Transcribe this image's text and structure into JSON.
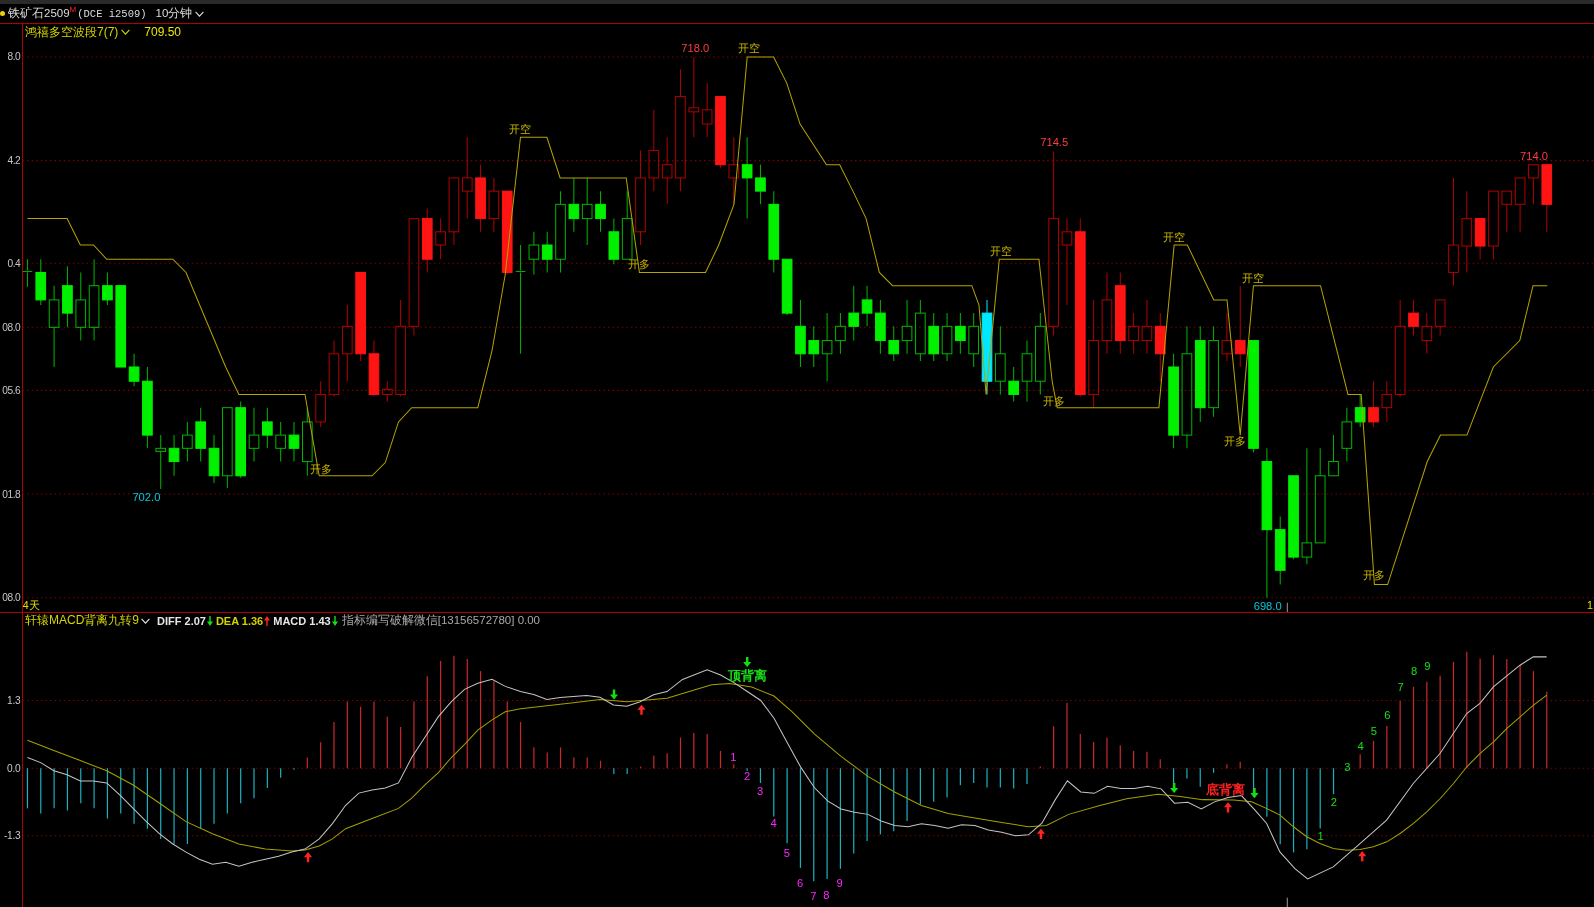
{
  "title_bar": {
    "symbol": "铁矿石2509$^{M}$",
    "exchange_code": "(DCE i2509)",
    "period": "10分钟"
  },
  "price_chart": {
    "legend": {
      "name": "鸿禧多空波段7(7)",
      "value": "709.50"
    },
    "y_axis_labels": [
      "8.0",
      "4.2",
      "0.4",
      "08.0",
      "05.6",
      "01.8",
      "08.0"
    ],
    "signals": [
      "开多",
      "开空",
      "开多",
      "开空",
      "开空",
      "开多",
      "开空",
      "开多",
      "开空",
      "开多"
    ],
    "price_marks": [
      {
        "text": "702.0",
        "kind": "low"
      },
      {
        "text": "718.0",
        "kind": "high"
      },
      {
        "text": "714.5",
        "kind": "high"
      },
      {
        "text": "698.0",
        "kind": "low"
      },
      {
        "text": "714.0",
        "kind": "high"
      }
    ],
    "time_labels": [
      "4天",
      "1"
    ]
  },
  "macd_header": {
    "name": "轩辕MACD背离九转9",
    "readings": [
      {
        "text": "DIFF 2.07",
        "color": "#e6e6e6",
        "rising": false
      },
      {
        "text": "DEA 1.36",
        "color": "#d2d200",
        "rising": true
      },
      {
        "text": "MACD 1.43",
        "color": "#e6e6e6",
        "rising": false
      }
    ],
    "note": "指标编写破解微信[13156572780] 0.00"
  },
  "macd_chart": {
    "y_axis_labels": [
      "1.3",
      "0.0",
      "-1.3"
    ],
    "divergence_labels": [
      {
        "text": "顶背离",
        "kind": "top"
      },
      {
        "text": "底背离",
        "kind": "bottom"
      }
    ],
    "sequences": [
      {
        "kind": "sell",
        "counts": [
          "1",
          "2",
          "3",
          "4",
          "5",
          "6",
          "7",
          "8",
          "9"
        ]
      },
      {
        "kind": "buy",
        "counts": [
          "1",
          "2",
          "3",
          "4",
          "5",
          "6",
          "7",
          "8",
          "9"
        ]
      }
    ]
  }
}
